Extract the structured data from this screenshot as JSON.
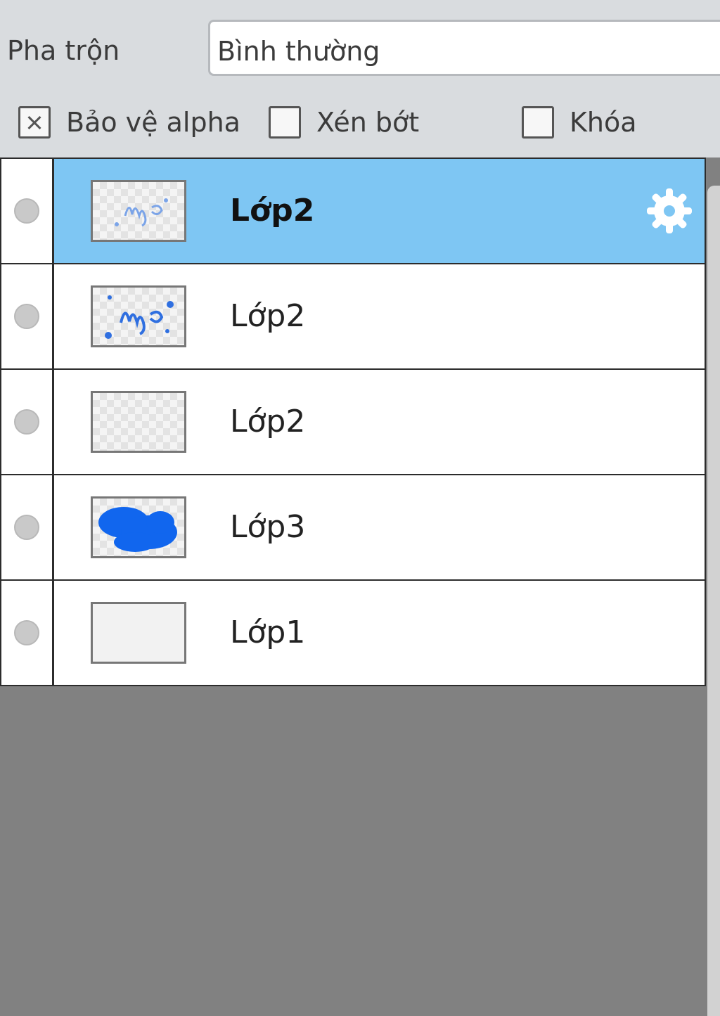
{
  "blend": {
    "label": "Pha trộn",
    "value": "Bình thường"
  },
  "options": [
    {
      "label": "Bảo vệ alpha",
      "checked": true
    },
    {
      "label": "Xén bớt",
      "checked": false
    },
    {
      "label": "Khóa",
      "checked": false
    }
  ],
  "layers": [
    {
      "name": "Lớp2",
      "selected": true,
      "thumbnail": "blue-script-faint"
    },
    {
      "name": "Lớp2",
      "selected": false,
      "thumbnail": "blue-script"
    },
    {
      "name": "Lớp2",
      "selected": false,
      "thumbnail": "transparent"
    },
    {
      "name": "Lớp3",
      "selected": false,
      "thumbnail": "blue-blob"
    },
    {
      "name": "Lớp1",
      "selected": false,
      "thumbnail": "white"
    }
  ],
  "colors": {
    "selected_row": "#7ec6f3",
    "thumbnail_blue": "#1166ee",
    "panel_bg": "#d9dcdf",
    "empty_area": "#818181"
  },
  "icons": {
    "settings": "gear-icon",
    "visibility": "visibility-dot-icon"
  }
}
